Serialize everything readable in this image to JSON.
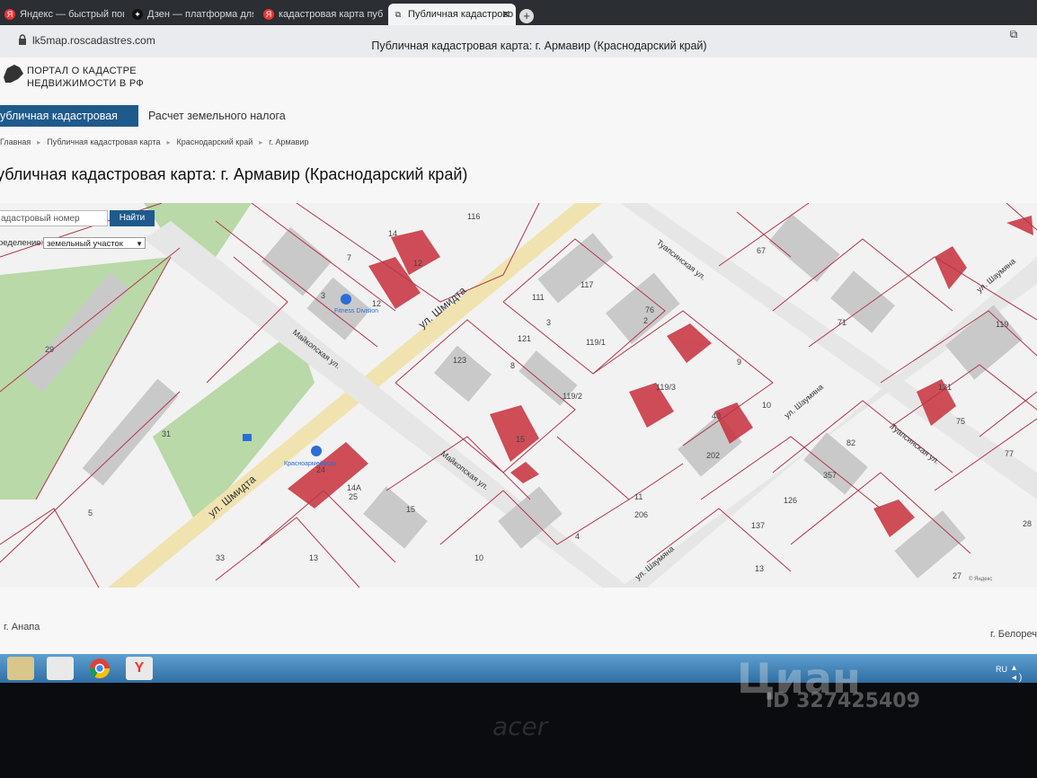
{
  "browser": {
    "tabs": [
      {
        "title": "Яндекс — быстрый поис",
        "icon": "yandex-icon"
      },
      {
        "title": "Дзен — платформа для",
        "icon": "zen-icon"
      },
      {
        "title": "кадастровая карта публи",
        "icon": "yandex-search-icon"
      },
      {
        "title": "Публичная кадастрово",
        "icon": "map-icon",
        "active": true
      }
    ],
    "url": "lk5map.roscadastres.com",
    "window_title": "Публичная кадастровая карта: г. Армавир (Краснодарский край)"
  },
  "header": {
    "portal_line1": "ПОРТАЛ О КАДАСТРЕ",
    "portal_line2": "НЕДВИЖИМОСТИ В РФ"
  },
  "nav": {
    "active": "убличная кадастровая карта",
    "tax": "Расчет земельного налога"
  },
  "breadcrumb": [
    "Главная",
    "Публичная кадастровая карта",
    "Краснодарский край",
    "г. Армавир"
  ],
  "page_title": "убличная кадастровая карта: г. Армавир (Краснодарский край)",
  "map_controls": {
    "search_placeholder": "адастровый номер",
    "search_button": "Найти",
    "definition_label": "ределение:",
    "definition_value": "земельный участок"
  },
  "map_labels": {
    "streets": [
      "ул. Шмидта",
      "ул. Шмидта",
      "Майкопская ул.",
      "Майкопская ул.",
      "Туапсинская ул.",
      "Туапсинская ул.",
      "ул. Шаумяна",
      "ул. Шаумяна",
      "ул. Шаумяна"
    ],
    "pois": [
      "Fitness Division",
      "Красноармейская"
    ],
    "numbers": [
      "116",
      "14",
      "12",
      "7",
      "3",
      "12",
      "76",
      "2",
      "111",
      "3",
      "117",
      "123",
      "121",
      "119/1",
      "119/3",
      "119/2",
      "10",
      "8",
      "15",
      "40",
      "202",
      "206",
      "14А",
      "25",
      "24",
      "15",
      "13",
      "29",
      "31",
      "33",
      "67",
      "71",
      "82",
      "121",
      "75",
      "77",
      "119",
      "357",
      "137",
      "126",
      "27",
      "13",
      "10",
      "4",
      "5",
      "9",
      "11",
      "28"
    ]
  },
  "map_copyright": "© Яндекс",
  "footer": {
    "left": "г. Анапа",
    "right": "г. Белореч"
  },
  "taskbar": {
    "lang": "RU"
  },
  "device": {
    "brand": "acer"
  },
  "watermark": {
    "line1": "Циан",
    "line2": "ID 327425409"
  },
  "colors": {
    "accent": "#1e5a8c",
    "parcel_fill": "#c8303c",
    "boundary": "#b0384a",
    "taskbar": "#3f84bd"
  }
}
